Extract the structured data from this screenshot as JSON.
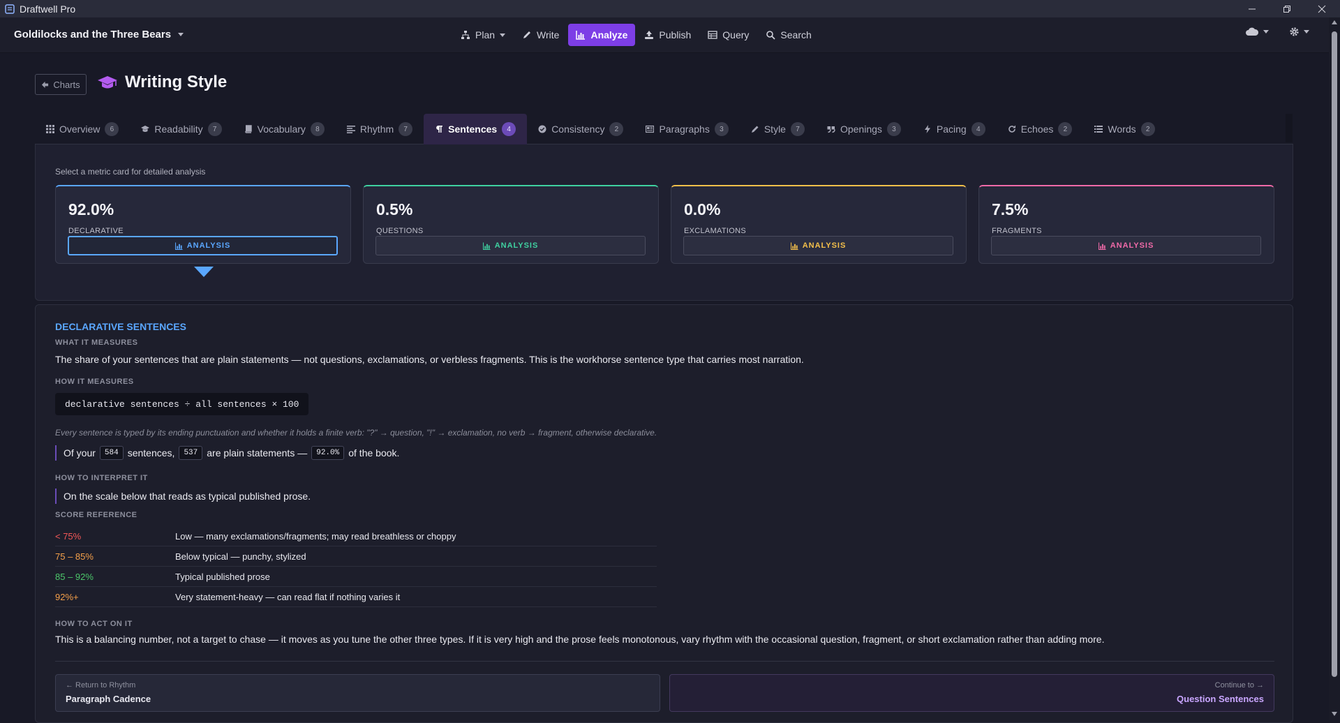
{
  "window": {
    "title": "Draftwell Pro"
  },
  "header": {
    "project_title": "Goldilocks and the Three Bears",
    "nav": [
      {
        "label": "Plan",
        "icon": "sitemap-icon",
        "has_caret": true
      },
      {
        "label": "Write",
        "icon": "pencil-icon"
      },
      {
        "label": "Analyze",
        "icon": "bar-chart-icon",
        "active": true
      },
      {
        "label": "Publish",
        "icon": "upload-icon"
      },
      {
        "label": "Query",
        "icon": "table-icon"
      },
      {
        "label": "Search",
        "icon": "search-icon"
      }
    ],
    "right_icons": [
      "cloud-icon",
      "gear-icon"
    ]
  },
  "page": {
    "back_label": "Charts",
    "title": "Writing Style",
    "title_icon": "graduation-cap-icon"
  },
  "tabs": [
    {
      "label": "Overview",
      "count": "6",
      "icon": "grid-icon"
    },
    {
      "label": "Readability",
      "count": "7",
      "icon": "graduation-cap-icon"
    },
    {
      "label": "Vocabulary",
      "count": "8",
      "icon": "book-icon"
    },
    {
      "label": "Rhythm",
      "count": "7",
      "icon": "align-left-icon"
    },
    {
      "label": "Sentences",
      "count": "4",
      "icon": "paragraph-icon",
      "active": true
    },
    {
      "label": "Consistency",
      "count": "2",
      "icon": "check-circle-icon"
    },
    {
      "label": "Paragraphs",
      "count": "3",
      "icon": "newspaper-icon"
    },
    {
      "label": "Style",
      "count": "7",
      "icon": "pen-icon"
    },
    {
      "label": "Openings",
      "count": "3",
      "icon": "quote-icon"
    },
    {
      "label": "Pacing",
      "count": "4",
      "icon": "bolt-icon"
    },
    {
      "label": "Echoes",
      "count": "2",
      "icon": "redo-icon"
    },
    {
      "label": "Words",
      "count": "2",
      "icon": "list-icon"
    }
  ],
  "cards_hint": "Select a metric card for detailed analysis",
  "cards": [
    {
      "value": "92.0%",
      "label": "DECLARATIVE",
      "button": "ANALYSIS",
      "color": "#5aa7ff",
      "selected": true
    },
    {
      "value": "0.5%",
      "label": "QUESTIONS",
      "button": "ANALYSIS",
      "color": "#3fd1a0"
    },
    {
      "value": "0.0%",
      "label": "EXCLAMATIONS",
      "button": "ANALYSIS",
      "color": "#f5c04a"
    },
    {
      "value": "7.5%",
      "label": "FRAGMENTS",
      "button": "ANALYSIS",
      "color": "#f06aa8"
    }
  ],
  "detail": {
    "title": "DECLARATIVE SENTENCES",
    "what_heading": "WHAT IT MEASURES",
    "what_text": "The share of your sentences that are plain statements — not questions, exclamations, or verbless fragments. This is the workhorse sentence type that carries most narration.",
    "how_heading": "HOW IT MEASURES",
    "formula": "declarative sentences ÷ all sentences × 100",
    "note": "Every sentence is typed by its ending punctuation and whether it holds a finite verb: \"?\" → question, \"!\" → exclamation, no verb → fragment, otherwise declarative.",
    "stat": {
      "prefix": "Of your",
      "total": "584",
      "mid1": "sentences,",
      "declarative": "537",
      "mid2": "are plain statements —",
      "percent": "92.0%",
      "suffix": "of the book."
    },
    "interpret_heading": "HOW TO INTERPRET IT",
    "interpret_text": "On the scale below that reads as typical published prose.",
    "score_heading": "SCORE REFERENCE",
    "scores": [
      {
        "range": "< 75%",
        "desc": "Low — many exclamations/fragments; may read breathless or choppy",
        "color": "#f25757"
      },
      {
        "range": "75 – 85%",
        "desc": "Below typical — punchy, stylized",
        "color": "#f5a04a"
      },
      {
        "range": "85 – 92%",
        "desc": "Typical published prose",
        "color": "#4cc76a"
      },
      {
        "range": "92%+",
        "desc": "Very statement-heavy — can read flat if nothing varies it",
        "color": "#f5a04a"
      }
    ],
    "act_heading": "HOW TO ACT ON IT",
    "act_text": "This is a balancing number, not a target to chase — it moves as you tune the other three types. If it is very high and the prose feels monotonous, vary rhythm with the occasional question, fragment, or short exclamation rather than adding more.",
    "prev": {
      "small": "← Return to Rhythm",
      "big": "Paragraph Cadence"
    },
    "next": {
      "small": "Continue to →",
      "big": "Question Sentences"
    }
  }
}
